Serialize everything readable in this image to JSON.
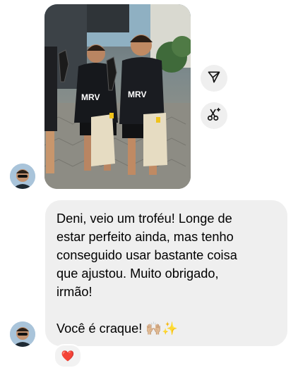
{
  "photo": {
    "jersey_text": "MRV"
  },
  "actions": {
    "share_icon": "paper-plane-icon",
    "edit_icon": "scissors-sparkle-icon"
  },
  "message": {
    "lines": [
      "Deni, veio um troféu! Longe de",
      "estar perfeito ainda, mas tenho",
      "conseguido usar bastante coisa",
      "que ajustou. Muito obrigado,",
      "irmão!"
    ],
    "closing": "Você é craque! 🙌🏼✨"
  },
  "reaction": {
    "emoji": "❤️"
  }
}
